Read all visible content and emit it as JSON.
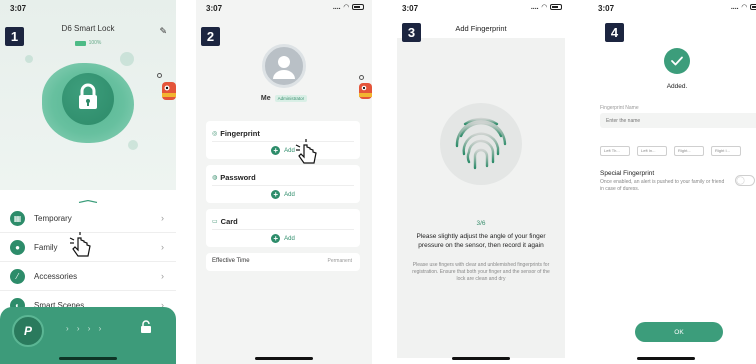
{
  "status_bar": {
    "time": "3:07",
    "signal": "....",
    "wifi": "wifi-icon"
  },
  "steps": [
    "1",
    "2",
    "3",
    "4"
  ],
  "panel1": {
    "title": "D6 Smart Lock",
    "battery_text": "100%",
    "menu": [
      {
        "label": "Temporary",
        "icon": "grid-icon"
      },
      {
        "label": "Family",
        "icon": "user-icon"
      },
      {
        "label": "Accessories",
        "icon": "accessory-icon"
      },
      {
        "label": "Smart Scenes",
        "icon": "scene-icon"
      }
    ],
    "unlock_symbol": "P",
    "arrows": "› › › ›",
    "arrow_right": "›"
  },
  "panel2": {
    "user_name": "Me",
    "role": "Administrator",
    "sections": [
      {
        "title": "Fingerprint",
        "icon": "fingerprint-icon",
        "add_label": "Add"
      },
      {
        "title": "Password",
        "icon": "password-icon",
        "add_label": "Add"
      },
      {
        "title": "Card",
        "icon": "card-icon",
        "add_label": "Add"
      }
    ],
    "effective_time_label": "Effective Time",
    "effective_time_value": "Permanent"
  },
  "panel3": {
    "title": "Add Fingerprint",
    "progress": "3/6",
    "instruction": "Please slightly adjust the angle of your finger pressure on the sensor, then record it again",
    "hint": "Please use fingers with clear and unblemished fingerprints for registration. Ensure that both your finger and the sensor of the lock are clean and dry"
  },
  "panel4": {
    "added_text": "Added.",
    "name_label": "Fingerprint Name",
    "name_placeholder": "Enter the name",
    "chips": [
      "Left Th...",
      "Left In...",
      "Right...",
      "Right I..."
    ],
    "special_title": "Special Fingerprint",
    "special_desc": "Once enabled, an alert is pushed to your family or friend in case of duress.",
    "ok_label": "OK"
  },
  "colors": {
    "accent": "#3c9d7b",
    "badge": "#1c2540"
  }
}
